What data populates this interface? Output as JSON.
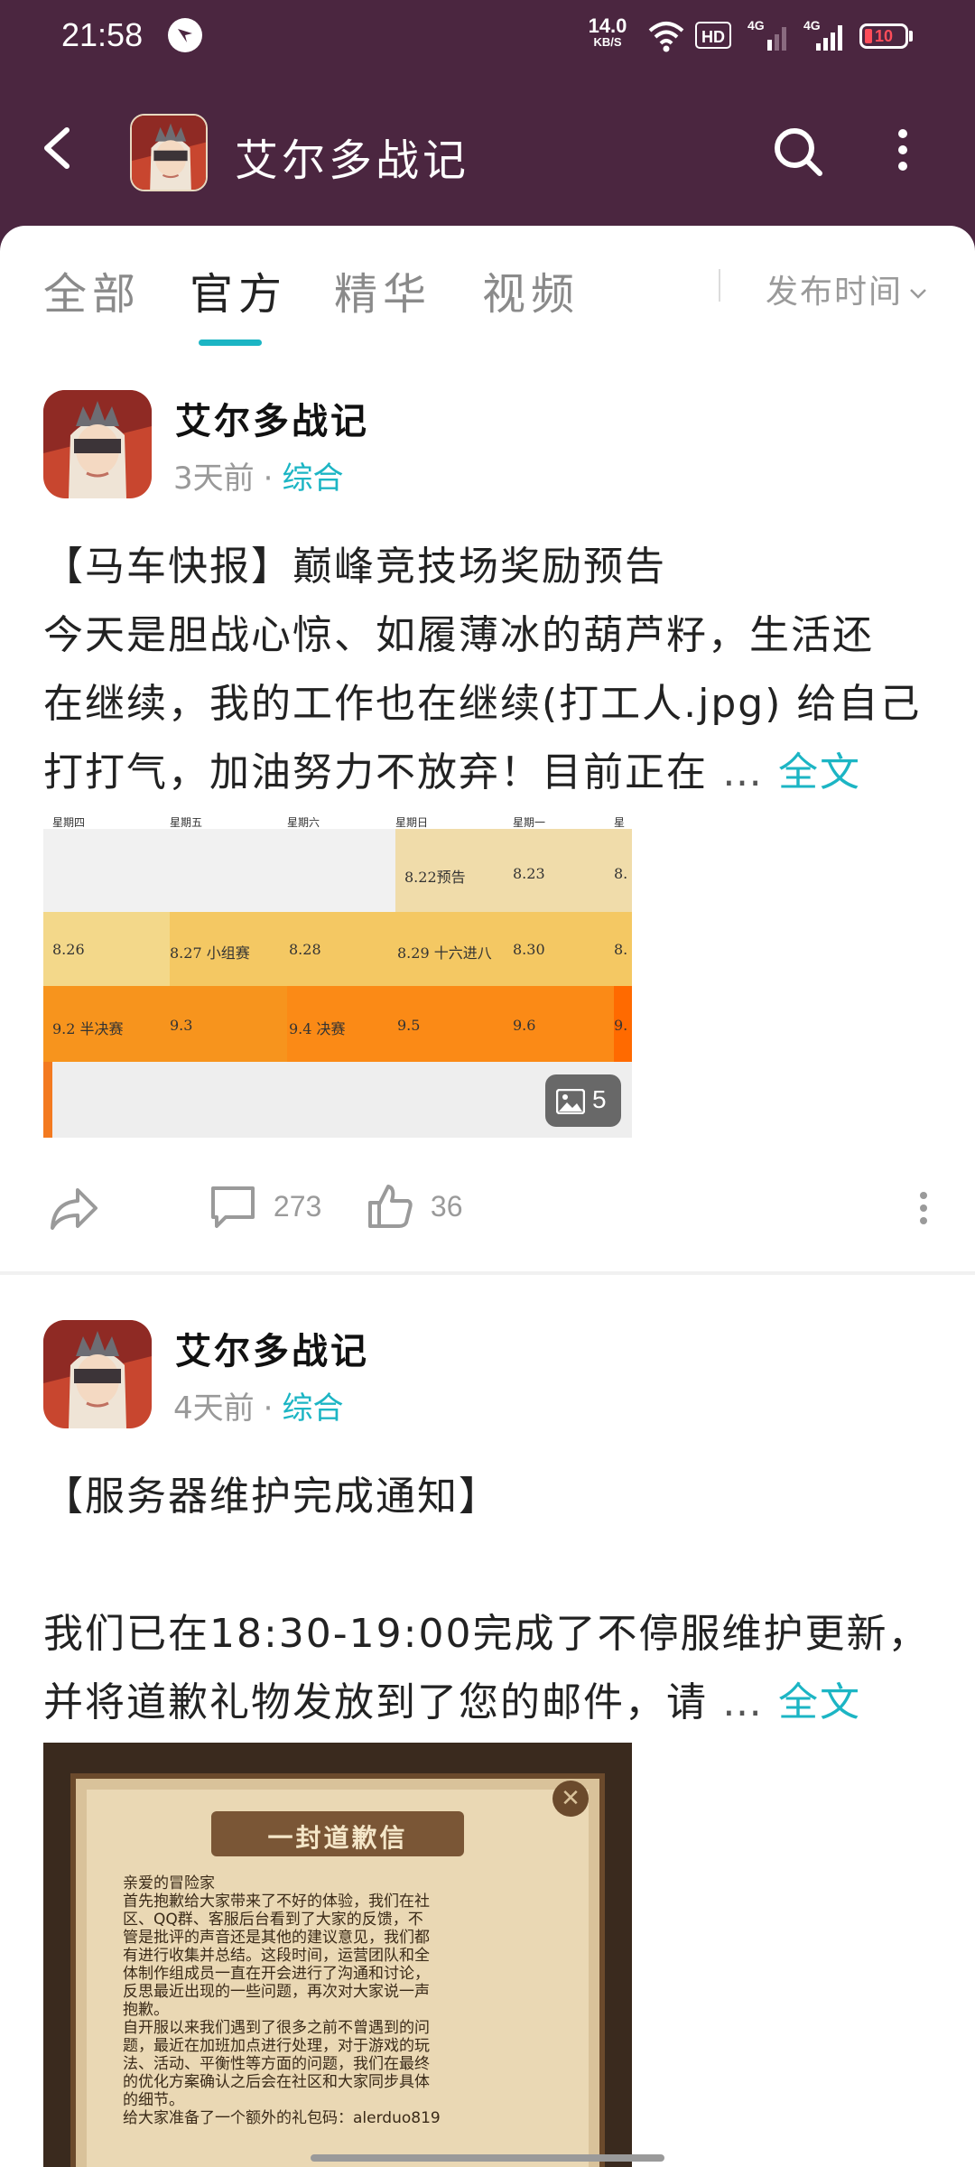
{
  "status_bar": {
    "time": "21:58",
    "net_speed": "14.0",
    "net_unit": "KB/S",
    "hd_label": "HD",
    "signal_1": "4G",
    "signal_2": "4G",
    "battery": "10",
    "battery_color": "#ff4d5a"
  },
  "header": {
    "title": "艾尔多战记",
    "back_icon": "back-arrow-icon",
    "search_icon": "search-icon",
    "more_icon": "more-vertical-icon",
    "background": "#4b2640"
  },
  "tabs": {
    "items": [
      {
        "label": "全部"
      },
      {
        "label": "官方"
      },
      {
        "label": "精华"
      },
      {
        "label": "视频"
      }
    ],
    "active": "官方",
    "sort_label": "发布时间",
    "accent": "#1cb5c4"
  },
  "posts": [
    {
      "author": "艾尔多战记",
      "time": "3天前",
      "category": "综合",
      "title": "【马车快报】巅峰竞技场奖励预告",
      "line1": "今天是胆战心惊、如履薄冰的葫芦籽，生活还",
      "line2": "在继续，我的工作也在继续(打工人.jpg) 给自己",
      "line3": "打打气，加油努力不放弃！目前正在",
      "ellipsis": "…",
      "more": "全文",
      "image_count": "5",
      "schedule": {
        "days": [
          "星期四",
          "星期五",
          "星期六",
          "星期日",
          "星期一",
          "星期二"
        ],
        "row1": [
          "8.22预告",
          "8.23",
          "8."
        ],
        "row2": [
          "8.26",
          "8.27  小组赛",
          "8.28",
          "8.29  十六进八",
          "8.30",
          "8."
        ],
        "row3": [
          "9.2  半决赛",
          "9.3",
          "9.4  决赛",
          "9.5",
          "9.6",
          "9."
        ]
      },
      "comments": "273",
      "likes": "36"
    },
    {
      "author": "艾尔多战记",
      "time": "4天前",
      "category": "综合",
      "title": "【服务器维护完成通知】",
      "line1": "我们已在18:30-19:00完成了不停服维护更新，",
      "line2": "并将道歉礼物发放到了您的邮件，请",
      "ellipsis": "…",
      "more": "全文",
      "letter": {
        "heading": "一封道歉信",
        "greeting": "亲爱的冒险家",
        "p1": [
          "首先抱歉给大家带来了不好的体验，我们在社",
          "区、QQ群、客服后台看到了大家的反馈，不",
          "管是批评的声音还是其他的建议意见，我们都",
          "有进行收集并总结。这段时间，运营团队和全",
          "体制作组成员一直在开会进行了沟通和讨论，",
          "反思最近出现的一些问题，再次对大家说一声",
          "抱歉。"
        ],
        "p2": [
          "自开服以来我们遇到了很多之前不曾遇到的问",
          "题，最近在加班加点进行处理，对于游戏的玩",
          "法、活动、平衡性等方面的问题，我们在最终",
          "的优化方案确认之后会在社区和大家同步具体",
          "的细节。",
          "给大家准备了一个额外的礼包码：alerduo819"
        ]
      }
    }
  ]
}
